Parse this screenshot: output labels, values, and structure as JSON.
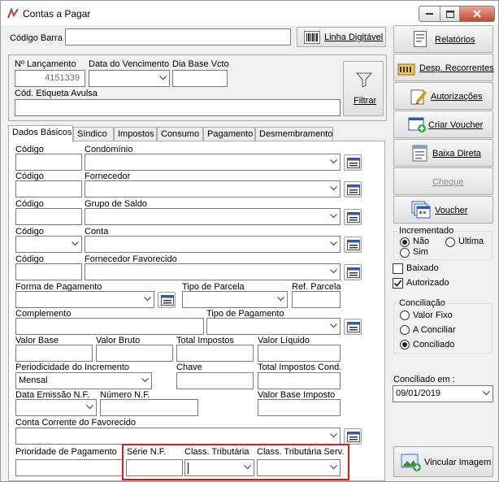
{
  "window": {
    "title": "Contas a Pagar"
  },
  "top": {
    "codigo_barra_label": "Código Barra",
    "codigo_barra_value": "",
    "linha_digitavel_label": "Linha Digitável",
    "lancamento_label": "Nº Lançamento",
    "lancamento_value": "4151339",
    "vencimento_label": "Data do Vencimento",
    "vencimento_value": "",
    "dia_base_label": "Dia Base Vcto",
    "dia_base_value": "",
    "etiqueta_label": "Cód. Etiqueta Avulsa",
    "etiqueta_value": "",
    "filtrar_label": "Filtrar"
  },
  "tabs": [
    "Dados Básicos",
    "Síndico",
    "Impostos",
    "Consumo",
    "Pagamento",
    "Desmembramento"
  ],
  "form": {
    "codigo": "Código",
    "condominio": "Condomínio",
    "fornecedor": "Fornecedor",
    "grupo_saldo": "Grupo de Saldo",
    "conta": "Conta",
    "fornecedor_favorecido": "Fornecedor Favorecido",
    "forma_pagamento": "Forma de Pagamento",
    "tipo_parcela": "Tipo de Parcela",
    "ref_parcela": "Ref. Parcela",
    "complemento": "Complemento",
    "tipo_pagamento": "Tipo de Pagamento",
    "valor_base": "Valor Base",
    "valor_bruto": "Valor Bruto",
    "total_impostos": "Total Impostos",
    "valor_liquido": "Valor Líquido",
    "periodicidade": "Periodicidade do Incremento",
    "periodicidade_value": "Mensal",
    "chave": "Chave",
    "total_impostos_cond": "Total Impostos Cond.",
    "data_emissao": "Data Emissão N.F.",
    "numero_nf": "Número N.F.",
    "valor_base_imposto": "Valor Base Imposto",
    "conta_corrente": "Conta Corrente do Favorecido",
    "prioridade": "Prioridade de Pagamento",
    "serie_nf": "Série N.F.",
    "class_tributaria": "Class. Tributária",
    "class_tributaria_serv": "Class. Tributária Serv."
  },
  "side": {
    "relatorios": "Relatórios",
    "desp_recorrentes": "Desp. Recorrentes",
    "autorizacoes": "Autorizações",
    "criar_voucher": "Criar Voucher",
    "baixa_direta": "Baixa Direta",
    "cheque": "Cheque",
    "voucher": "Voucher",
    "incrementado_title": "Incrementado",
    "inc_nao": "Não",
    "inc_ultima": "Ultima",
    "inc_sim": "Sim",
    "baixado": "Baixado",
    "autorizado": "Autorizado",
    "conciliacao_title": "Conciliação",
    "valor_fixo": "Valor Fixo",
    "a_conciliar": "A Conciliar",
    "conciliado": "Conciliado",
    "conciliado_em_label": "Conciliado em :",
    "conciliado_em_value": "09/01/2019",
    "vincular_imagem": "Vincular Imagem"
  },
  "colors": {
    "highlight_box": "#d81d1d",
    "window_bg": "#f0f0f0",
    "close_button": "#c9452e"
  }
}
